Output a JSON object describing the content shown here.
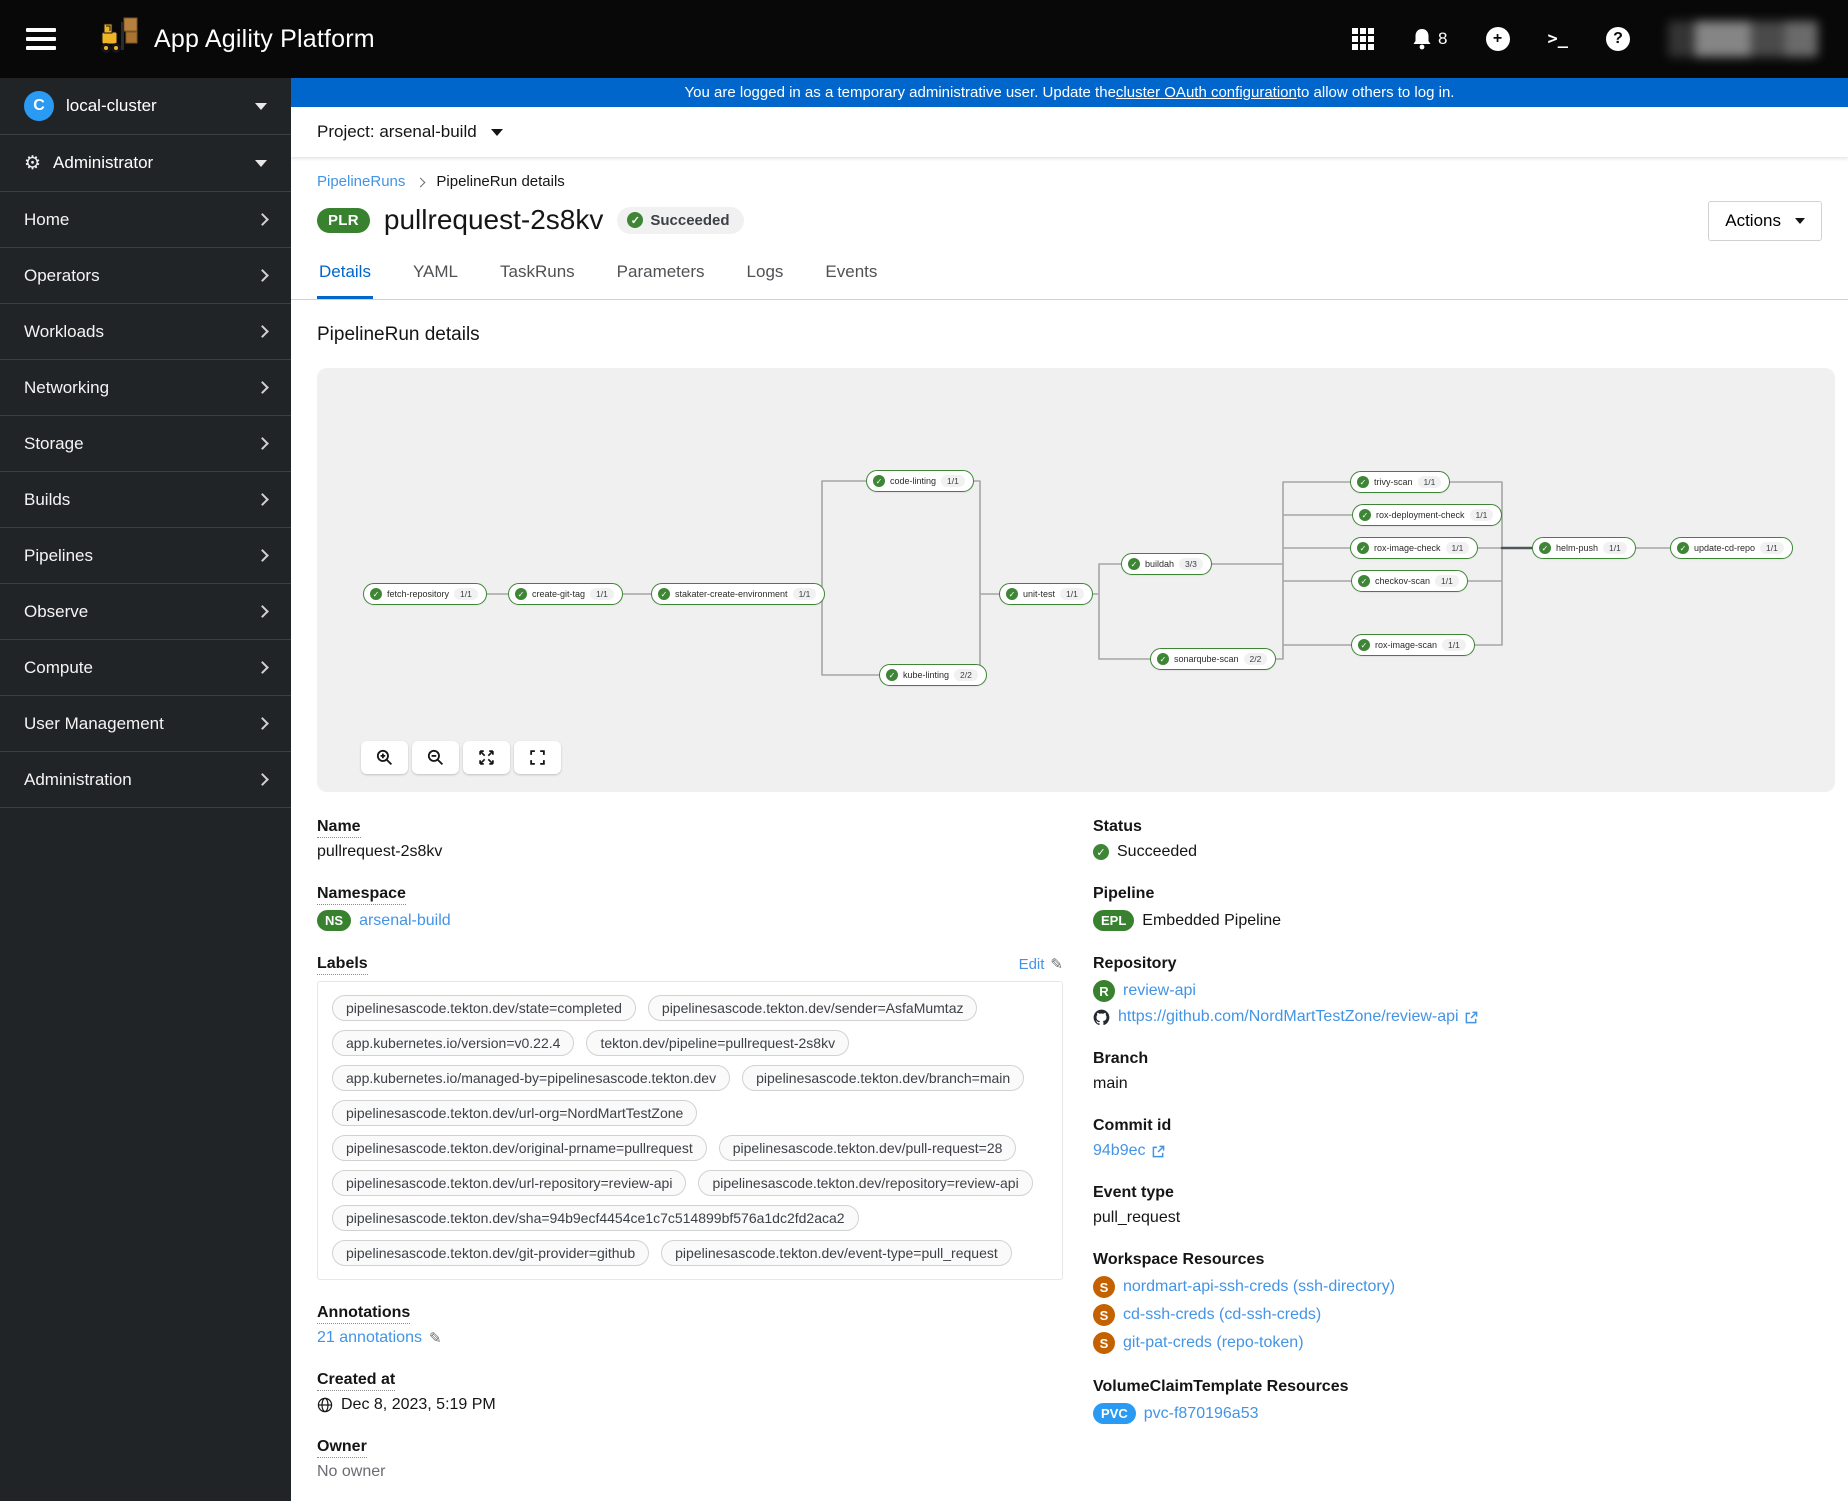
{
  "masthead": {
    "title": "App Agility Platform",
    "notification_count": "8"
  },
  "banner": {
    "text_before": "You are logged in as a temporary administrative user. Update the ",
    "link_text": "cluster OAuth configuration",
    "text_after": " to allow others to log in."
  },
  "project_bar": {
    "label": "Project: arsenal-build"
  },
  "sidebar": {
    "cluster": {
      "icon_letter": "C",
      "label": "local-cluster"
    },
    "perspective": {
      "label": "Administrator"
    },
    "items": [
      {
        "label": "Home"
      },
      {
        "label": "Operators"
      },
      {
        "label": "Workloads"
      },
      {
        "label": "Networking"
      },
      {
        "label": "Storage"
      },
      {
        "label": "Builds"
      },
      {
        "label": "Pipelines"
      },
      {
        "label": "Observe"
      },
      {
        "label": "Compute"
      },
      {
        "label": "User Management"
      },
      {
        "label": "Administration"
      }
    ]
  },
  "breadcrumb": {
    "parent": "PipelineRuns",
    "current": "PipelineRun details"
  },
  "page_header": {
    "resource_badge": "PLR",
    "title": "pullrequest-2s8kv",
    "status": "Succeeded",
    "actions_label": "Actions"
  },
  "tabs": [
    {
      "label": "Details",
      "active": true
    },
    {
      "label": "YAML",
      "active": false
    },
    {
      "label": "TaskRuns",
      "active": false
    },
    {
      "label": "Parameters",
      "active": false
    },
    {
      "label": "Logs",
      "active": false
    },
    {
      "label": "Events",
      "active": false
    }
  ],
  "section_title": "PipelineRun details",
  "pipeline_graph": {
    "tasks": [
      {
        "name": "fetch-repository",
        "runs": "1/1",
        "status": "succeeded"
      },
      {
        "name": "create-git-tag",
        "runs": "1/1",
        "status": "succeeded"
      },
      {
        "name": "stakater-create-environment",
        "runs": "1/1",
        "status": "succeeded"
      },
      {
        "name": "code-linting",
        "runs": "1/1",
        "status": "succeeded"
      },
      {
        "name": "kube-linting",
        "runs": "2/2",
        "status": "succeeded"
      },
      {
        "name": "unit-test",
        "runs": "1/1",
        "status": "succeeded"
      },
      {
        "name": "buildah",
        "runs": "3/3",
        "status": "succeeded"
      },
      {
        "name": "sonarqube-scan",
        "runs": "2/2",
        "status": "succeeded"
      },
      {
        "name": "trivy-scan",
        "runs": "1/1",
        "status": "succeeded"
      },
      {
        "name": "rox-deployment-check",
        "runs": "1/1",
        "status": "succeeded"
      },
      {
        "name": "rox-image-check",
        "runs": "1/1",
        "status": "succeeded"
      },
      {
        "name": "checkov-scan",
        "runs": "1/1",
        "status": "succeeded"
      },
      {
        "name": "rox-image-scan",
        "runs": "1/1",
        "status": "succeeded"
      },
      {
        "name": "helm-push",
        "runs": "1/1",
        "status": "succeeded"
      },
      {
        "name": "update-cd-repo",
        "runs": "1/1",
        "status": "succeeded"
      }
    ]
  },
  "details": {
    "name_label": "Name",
    "name_value": "pullrequest-2s8kv",
    "namespace_label": "Namespace",
    "namespace_badge": "NS",
    "namespace_value": "arsenal-build",
    "labels_label": "Labels",
    "edit_label": "Edit",
    "labels": [
      "pipelinesascode.tekton.dev/state=completed",
      "pipelinesascode.tekton.dev/sender=AsfaMumtaz",
      "app.kubernetes.io/version=v0.22.4",
      "tekton.dev/pipeline=pullrequest-2s8kv",
      "app.kubernetes.io/managed-by=pipelinesascode.tekton.dev",
      "pipelinesascode.tekton.dev/branch=main",
      "pipelinesascode.tekton.dev/url-org=NordMartTestZone",
      "pipelinesascode.tekton.dev/original-prname=pullrequest",
      "pipelinesascode.tekton.dev/pull-request=28",
      "pipelinesascode.tekton.dev/url-repository=review-api",
      "pipelinesascode.tekton.dev/repository=review-api",
      "pipelinesascode.tekton.dev/sha=94b9ecf4454ce1c7c514899bf576a1dc2fd2aca2",
      "pipelinesascode.tekton.dev/git-provider=github",
      "pipelinesascode.tekton.dev/event-type=pull_request"
    ],
    "annotations_label": "Annotations",
    "annotations_value": "21 annotations",
    "created_label": "Created at",
    "created_value": "Dec 8, 2023, 5:19 PM",
    "owner_label": "Owner",
    "owner_value": "No owner"
  },
  "status_panel": {
    "status_label": "Status",
    "status_value": "Succeeded",
    "pipeline_label": "Pipeline",
    "pipeline_badge": "EPL",
    "pipeline_value": "Embedded Pipeline",
    "repository_label": "Repository",
    "repository_badge": "R",
    "repository_name": "review-api",
    "repository_url": "https://github.com/NordMartTestZone/review-api",
    "branch_label": "Branch",
    "branch_value": "main",
    "commit_label": "Commit id",
    "commit_value": "94b9ec",
    "event_type_label": "Event type",
    "event_type_value": "pull_request",
    "workspace_label": "Workspace Resources",
    "workspaces": [
      {
        "badge": "S",
        "text": "nordmart-api-ssh-creds (ssh-directory)"
      },
      {
        "badge": "S",
        "text": "cd-ssh-creds (cd-ssh-creds)"
      },
      {
        "badge": "S",
        "text": "git-pat-creds (repo-token)"
      }
    ],
    "vct_label": "VolumeClaimTemplate Resources",
    "vct_badge": "PVC",
    "vct_value": "pvc-f870196a53"
  },
  "colors": {
    "accent_blue": "#0066cc",
    "link_blue": "#4394e5",
    "success_green": "#3e8635",
    "badge_green": "#38812f",
    "secret_orange": "#c46100",
    "pvc_blue": "#2b9af3",
    "masthead_black": "#080808",
    "sidebar_dark": "#212427",
    "graph_bg": "#f0f0f0"
  }
}
